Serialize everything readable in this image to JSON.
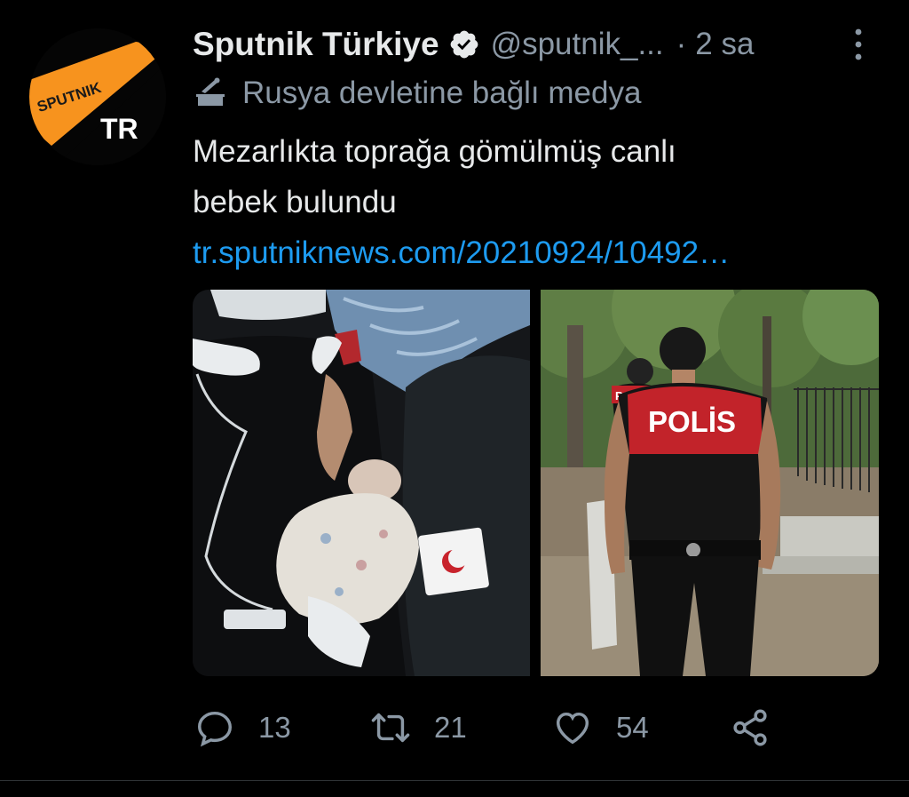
{
  "tweet": {
    "author": {
      "display_name": "Sputnik Türkiye",
      "handle": "@sputnik_...",
      "verified": true,
      "avatar_text_top": "SPUTNIK",
      "avatar_text_bottom": "TR"
    },
    "separator": "·",
    "time": "2 sa",
    "affiliation_label": "Rusya devletine bağlı medya",
    "text_line1": "Mezarlıkta toprağa gömülmüş canlı",
    "text_line2": "bebek bulundu",
    "link": "tr.sputniknews.com/20210924/10492…",
    "media": {
      "right_photo_vest_text": "POLİS",
      "right_photo_vest_text_back": "POLİS"
    },
    "actions": {
      "reply_count": "13",
      "retweet_count": "21",
      "like_count": "54"
    }
  },
  "icons": {
    "verified": "verified-badge-icon",
    "more": "more-vertical-icon",
    "affiliation": "state-media-icon",
    "reply": "reply-icon",
    "retweet": "retweet-icon",
    "like": "heart-icon",
    "share": "share-icon"
  },
  "colors": {
    "background": "#000000",
    "text_primary": "#e7e9ea",
    "text_secondary": "#8b98a5",
    "link": "#1d9bf0",
    "avatar_orange": "#f7931e"
  }
}
